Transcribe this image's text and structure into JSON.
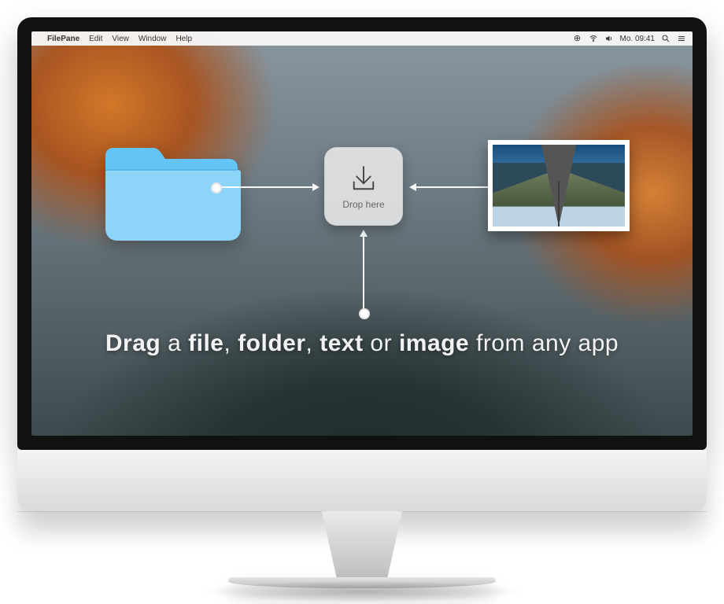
{
  "menubar": {
    "apple": "",
    "app": "FilePane",
    "items": [
      "Edit",
      "View",
      "Window",
      "Help"
    ],
    "clock": "Mo. 09:41"
  },
  "dropzone": {
    "label": "Drop here"
  },
  "tagline": {
    "w1": "Drag",
    "w2": "a",
    "w3": "file",
    "c1": ",",
    "w4": "folder",
    "c2": ",",
    "w5": "text",
    "w6": "or",
    "w7": "image",
    "w8": "from any app"
  }
}
